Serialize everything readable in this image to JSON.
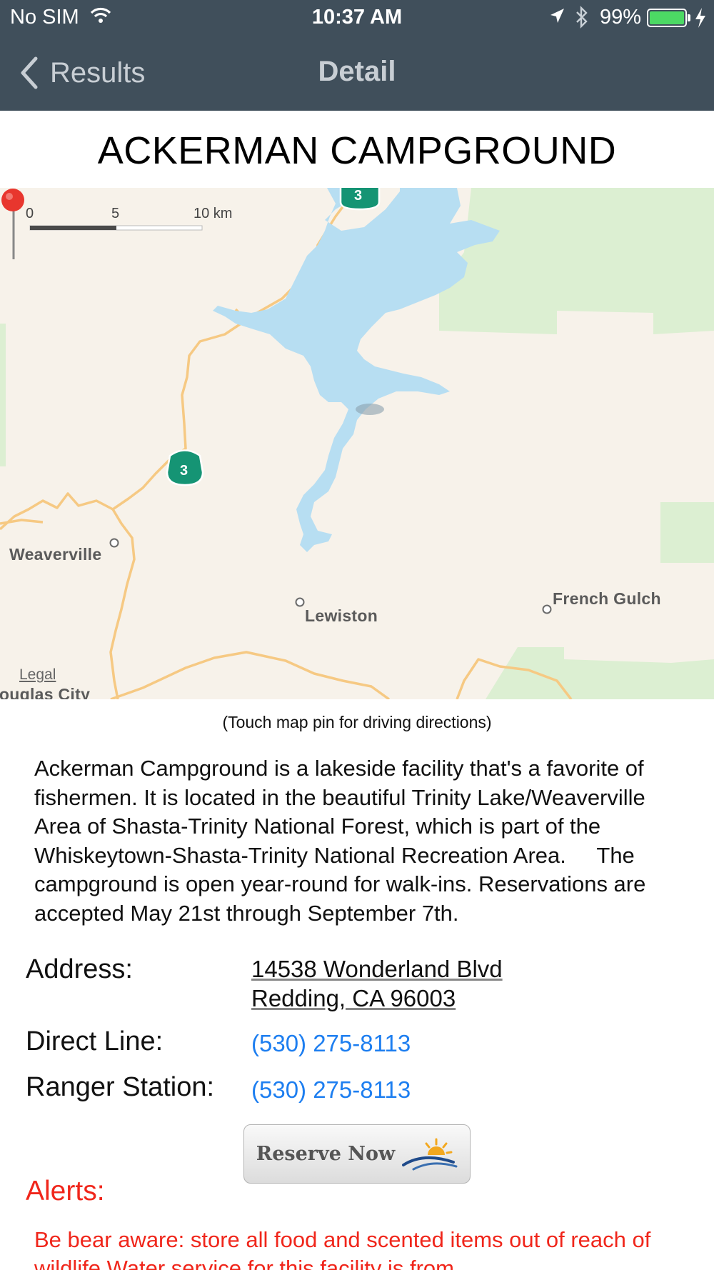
{
  "status_bar": {
    "carrier": "No SIM",
    "time": "10:37 AM",
    "battery": "99%",
    "battery_level": 0.99,
    "icons": [
      "wifi-icon",
      "location-arrow-icon",
      "bluetooth-icon",
      "battery-icon",
      "charging-bolt-icon"
    ]
  },
  "nav": {
    "back_label": "Results",
    "title": "Detail"
  },
  "site_title": "ACKERMAN CAMPGROUND",
  "map": {
    "scale_labels": [
      "0",
      "5",
      "10 km"
    ],
    "highway_label": "3",
    "places": [
      "Weaverville",
      "Lewiston",
      "French Gulch",
      "Douglas City"
    ],
    "legal": "Legal",
    "colors": {
      "land": "#f7f2ea",
      "water": "#b7def2",
      "forest": "#dcefd2",
      "road": "#f6c983",
      "highway": "#159474",
      "pin": "#e8362e"
    }
  },
  "hint": "(Touch map pin for driving directions)",
  "description": "Ackerman Campground is a lakeside facility that's a favorite of fishermen. It is located in the beautiful Trinity Lake/Weaverville Area of Shasta-Trinity National Forest, which is part of the Whiskeytown-Shasta-Trinity National Recreation Area.     The campground is open year-round for walk-ins. Reservations are accepted May 21st through September 7th.",
  "details": {
    "address_label": "Address:",
    "address_line1": "14538 Wonderland Blvd",
    "address_line2": "Redding, CA 96003",
    "direct_label": "Direct Line:",
    "direct_phone": "(530) 275-8113",
    "ranger_label": "Ranger Station:",
    "ranger_phone": "(530) 275-8113"
  },
  "reserve_button": "Reserve Now",
  "alerts": {
    "label": "Alerts:",
    "text": "Be bear aware: store all food and scented items out of reach of wildlife Water service for this facility is from"
  }
}
